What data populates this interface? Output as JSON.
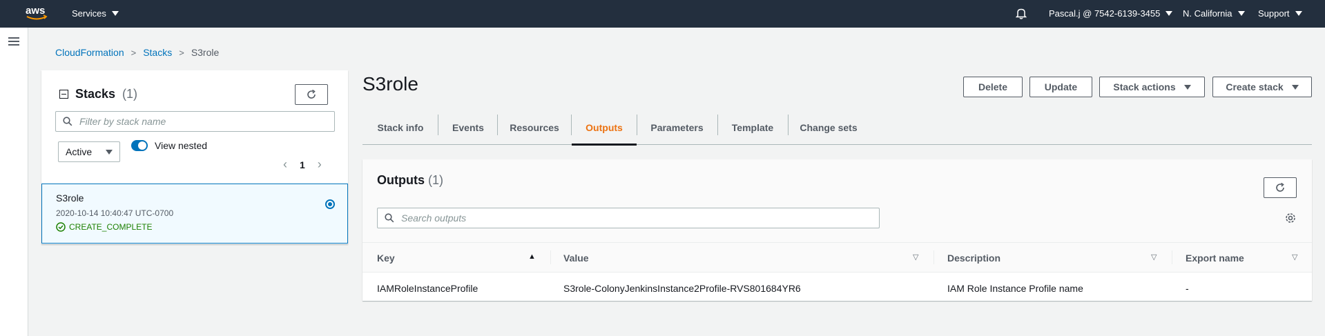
{
  "nav": {
    "logo_text": "aws",
    "services_label": "Services",
    "account_label": "Pascal.j @ 7542-6139-3455",
    "region_label": "N. California",
    "support_label": "Support"
  },
  "breadcrumb": {
    "items": [
      "CloudFormation",
      "Stacks"
    ],
    "current": "S3role"
  },
  "stacks_panel": {
    "title": "Stacks",
    "count": "(1)",
    "filter_placeholder": "Filter by stack name",
    "status_filter": "Active",
    "view_nested_label": "View nested",
    "page": "1",
    "stacks": [
      {
        "name": "S3role",
        "date": "2020-10-14 10:40:47 UTC-0700",
        "status": "CREATE_COMPLETE"
      }
    ]
  },
  "main": {
    "title": "S3role",
    "buttons": {
      "delete": "Delete",
      "update": "Update",
      "stack_actions": "Stack actions",
      "create_stack": "Create stack"
    },
    "tabs": [
      {
        "label": "Stack info"
      },
      {
        "label": "Events"
      },
      {
        "label": "Resources"
      },
      {
        "label": "Outputs"
      },
      {
        "label": "Parameters"
      },
      {
        "label": "Template"
      },
      {
        "label": "Change sets"
      }
    ],
    "active_tab": "Outputs"
  },
  "outputs": {
    "title": "Outputs",
    "count": "(1)",
    "search_placeholder": "Search outputs",
    "columns": [
      "Key",
      "Value",
      "Description",
      "Export name"
    ],
    "rows": [
      {
        "key": "IAMRoleInstanceProfile",
        "value": "S3role-ColonyJenkinsInstance2Profile-RVS801684YR6",
        "description": "IAM Role Instance Profile name",
        "export_name": "-"
      }
    ]
  },
  "colors": {
    "nav_bg": "#232f3e",
    "link": "#0073bb",
    "active_tab": "#ec7211",
    "success": "#1d8102"
  }
}
